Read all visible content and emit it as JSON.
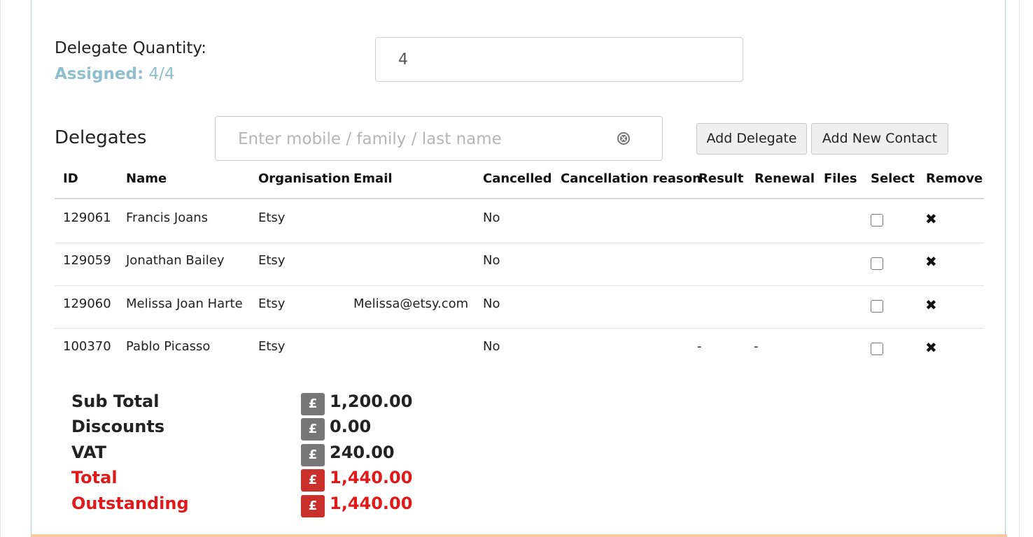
{
  "quantity": {
    "label": "Delegate Quantity:",
    "assigned_label": "Assigned:",
    "assigned_value": "4/4",
    "value": "4"
  },
  "delegates": {
    "title": "Delegates",
    "search_placeholder": "Enter mobile / family / last name",
    "add_delegate_label": "Add Delegate",
    "add_contact_label": "Add New Contact"
  },
  "table": {
    "headers": [
      "ID",
      "Name",
      "Organisation",
      "Email",
      "Cancelled",
      "Cancellation reason",
      "Result",
      "Renewal",
      "Files",
      "Select",
      "Remove"
    ],
    "rows": [
      {
        "id": "129061",
        "name": "Francis Joans",
        "organisation": "Etsy",
        "email": "",
        "cancelled": "No",
        "reason": "",
        "result": "",
        "renewal": "",
        "files": "",
        "selected": false,
        "remove": "✖"
      },
      {
        "id": "129059",
        "name": "Jonathan Bailey",
        "organisation": "Etsy",
        "email": "",
        "cancelled": "No",
        "reason": "",
        "result": "",
        "renewal": "",
        "files": "",
        "selected": false,
        "remove": "✖"
      },
      {
        "id": "129060",
        "name": "Melissa Joan Harte",
        "organisation": "Etsy",
        "email": "Melissa@etsy.com",
        "cancelled": "No",
        "reason": "",
        "result": "",
        "renewal": "",
        "files": "",
        "selected": false,
        "remove": "✖"
      },
      {
        "id": "100370",
        "name": "Pablo Picasso",
        "organisation": "Etsy",
        "email": "",
        "cancelled": "No",
        "reason": "",
        "result": "-",
        "renewal": "-",
        "files": "",
        "selected": false,
        "remove": "✖"
      }
    ]
  },
  "totals": {
    "currency_symbol": "£",
    "items": [
      {
        "label": "Sub Total",
        "amount": "1,200.00",
        "highlight": false
      },
      {
        "label": "Discounts",
        "amount": "0.00",
        "highlight": false
      },
      {
        "label": "VAT",
        "amount": "240.00",
        "highlight": false
      },
      {
        "label": "Total",
        "amount": "1,440.00",
        "highlight": true
      },
      {
        "label": "Outstanding",
        "amount": "1,440.00",
        "highlight": true
      }
    ]
  },
  "colors": {
    "assigned": "#8fbfcf",
    "highlight_text": "#e01a1a",
    "highlight_badge": "#c9302c",
    "neutral_badge": "#777777",
    "panel_border": "#a9cde4"
  },
  "icons": {
    "clear": "clear-circle-icon",
    "remove": "remove-x-icon"
  }
}
